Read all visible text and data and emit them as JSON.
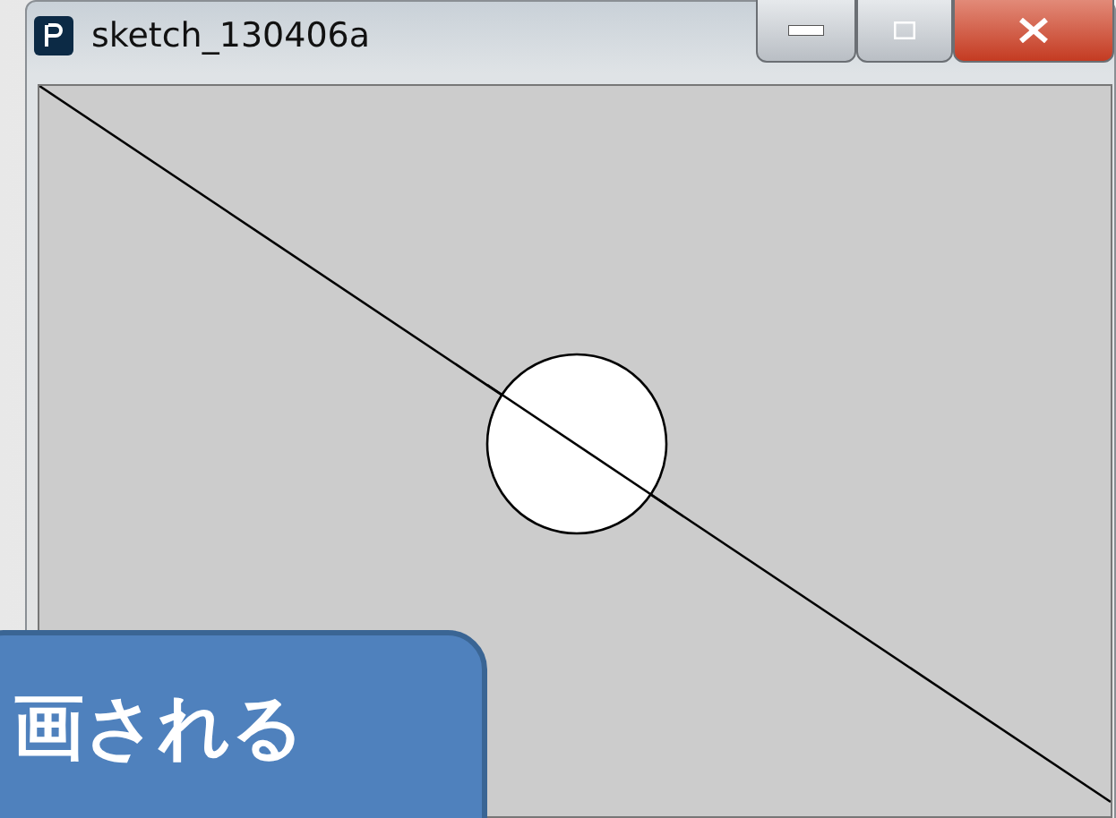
{
  "window": {
    "title": "sketch_130406a"
  },
  "callout": {
    "text": "画される"
  }
}
